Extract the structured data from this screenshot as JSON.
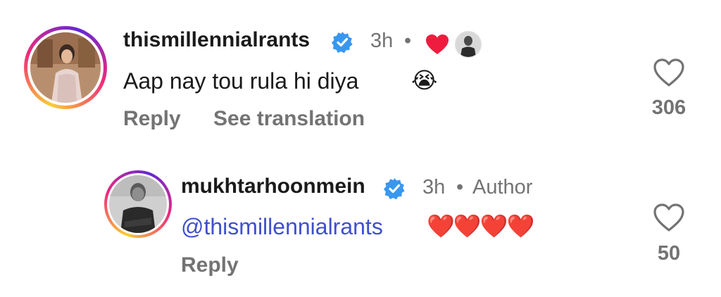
{
  "comments": [
    {
      "username": "thismillennialrants",
      "time": "3h",
      "separator": "•",
      "text": "Aap nay tou rula hi diya",
      "emoji": "😭",
      "reply_label": "Reply",
      "translate_label": "See translation",
      "likes": "306"
    },
    {
      "username": "mukhtarhoonmein",
      "time": "3h",
      "separator": "•",
      "author_label": "Author",
      "mention": "@thismillennialrants",
      "emoji_hearts": "❤️❤️❤️❤️",
      "reply_label": "Reply",
      "likes": "50"
    }
  ],
  "colors": {
    "heart_red": "#ee1d3f",
    "verified_blue": "#3897f0",
    "mention_blue": "#3f4fcf",
    "muted_gray": "#737373"
  }
}
